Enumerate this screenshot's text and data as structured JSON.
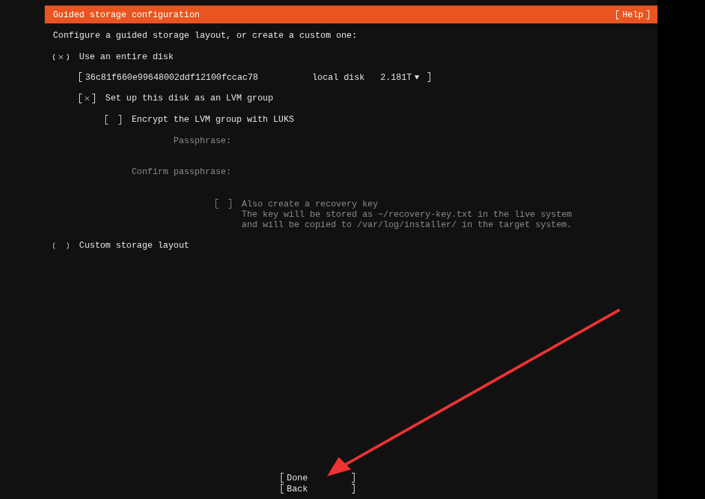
{
  "header": {
    "title": "Guided storage configuration",
    "help_button": "Help"
  },
  "intro": "Configure a guided storage layout, or create a custom one:",
  "options": [
    {
      "kind": "radio",
      "label": "Use an entire disk",
      "selected": true
    },
    {
      "kind": "disk",
      "id": "36c81f660e99648002ddf12100fccac78",
      "type": "local disk",
      "size": "2.181T"
    },
    {
      "kind": "checkbox",
      "label": "Set up this disk as an LVM group",
      "checked": true,
      "disabled": false
    },
    {
      "kind": "checkbox",
      "label": "Encrypt the LVM group with LUKS",
      "checked": false,
      "disabled": false
    },
    {
      "kind": "field",
      "label": "Passphrase:",
      "disabled": true
    },
    {
      "kind": "field",
      "label": "Confirm passphrase:",
      "disabled": true
    },
    {
      "kind": "recovery",
      "label": "Also create a recovery key",
      "help": [
        "The key will be stored as ~/recovery-key.txt in the live system",
        "and will be copied to /var/log/installer/ in the target system."
      ],
      "checked": false,
      "disabled": true
    },
    {
      "kind": "radio",
      "label": "Custom storage layout",
      "selected": false
    }
  ],
  "buttons": [
    {
      "label": "Done"
    },
    {
      "label": "Back"
    }
  ]
}
